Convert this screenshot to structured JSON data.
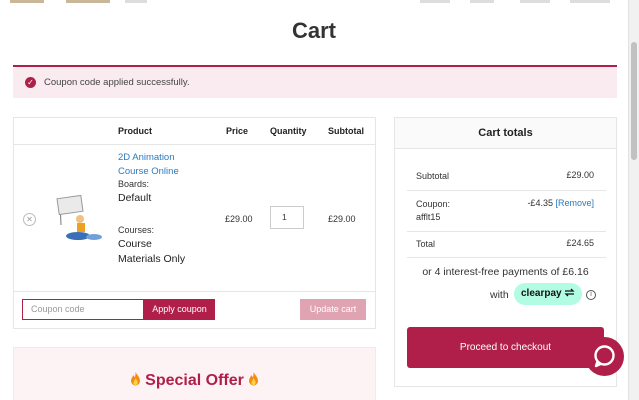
{
  "page": {
    "title": "Cart"
  },
  "notice": {
    "message": "Coupon code applied successfully."
  },
  "cart_table": {
    "headers": {
      "product": "Product",
      "price": "Price",
      "quantity": "Quantity",
      "subtotal": "Subtotal"
    },
    "item": {
      "name_line1": "2D Animation",
      "name_line2": "Course Online",
      "boards_label": "Boards:",
      "boards_value": "Default",
      "courses_label": "Courses:",
      "courses_value_line1": "Course",
      "courses_value_line2": "Materials Only",
      "price": "£29.00",
      "quantity": "1",
      "subtotal": "£29.00",
      "remove_glyph": "✕"
    },
    "coupon_placeholder": "Coupon code",
    "apply_coupon_label": "Apply coupon",
    "update_cart_label": "Update cart"
  },
  "offer": {
    "title": "Special Offer"
  },
  "totals": {
    "heading": "Cart totals",
    "subtotal_label": "Subtotal",
    "subtotal_value": "£29.00",
    "coupon_label_line1": "Coupon:",
    "coupon_label_line2": "afflt15",
    "coupon_value": "-£4.35",
    "coupon_remove": "[Remove]",
    "total_label": "Total",
    "total_value": "£24.65",
    "installments_text": "or 4 interest-free payments of £6.16",
    "with_text": "with",
    "clearpay_label": "clearpay",
    "info_glyph": "i",
    "checkout_label": "Proceed to checkout"
  },
  "colors": {
    "brand": "#b01f4a",
    "brand_light": "#e0a3b2",
    "notice_bg": "#f9ebef",
    "link": "#2a7bc0",
    "clearpay_bg": "#b2fce4"
  },
  "icons": {
    "notice": "check-circle-icon",
    "remove": "close-circle-icon",
    "offer": "flame-icon",
    "chat": "chat-bubble-icon",
    "info": "info-icon"
  }
}
